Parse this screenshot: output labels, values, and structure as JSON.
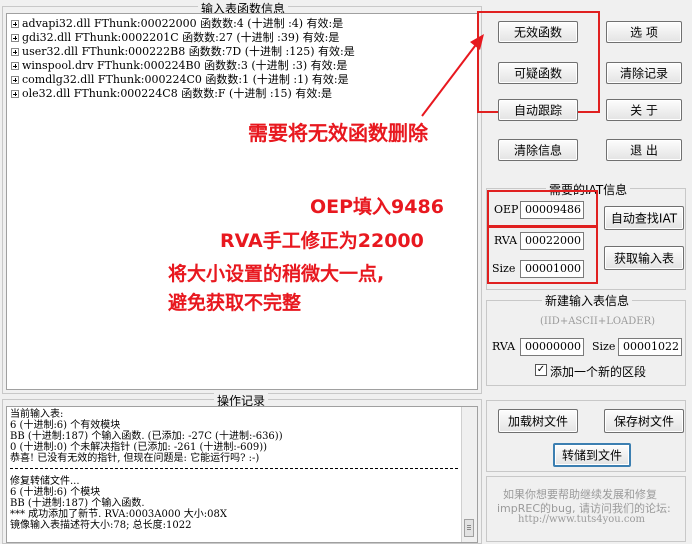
{
  "import_group": {
    "title": "输入表函数信息",
    "items": [
      "advapi32.dll FThunk:00022000 函数数:4 (十进制 :4) 有效:是",
      "gdi32.dll FThunk:0002201C 函数数:27 (十进制 :39) 有效:是",
      "user32.dll FThunk:000222B8 函数数:7D (十进制 :125) 有效:是",
      "winspool.drv FThunk:000224B0 函数数:3 (十进制 :3) 有效:是",
      "comdlg32.dll FThunk:000224C0 函数数:1 (十进制 :1) 有效:是",
      "ole32.dll FThunk:000224C8 函数数:F (十进制 :15) 有效:是"
    ]
  },
  "buttons": {
    "invalid_funcs": "无效函数",
    "options": "选  项",
    "suspicious_funcs": "可疑函数",
    "clear_log": "清除记录",
    "auto_trace": "自动跟踪",
    "about": "关  于",
    "clear_info": "清除信息",
    "exit": "退  出",
    "auto_find_iat": "自动查找IAT",
    "get_imports": "获取输入表",
    "load_tree": "加载树文件",
    "save_tree": "保存树文件",
    "dump_to_file": "转储到文件"
  },
  "annotations": {
    "delete_invalid": "需要将无效函数删除",
    "oep_fill": "OEP填入9486",
    "rva_fix": "RVA手工修正为22000",
    "size_line1": "将大小设置的稍微大一点,",
    "size_line2": "避免获取不完整"
  },
  "iat_group": {
    "title": "需要的IAT信息",
    "oep_label": "OEP",
    "oep_value": "00009486",
    "rva_label": "RVA",
    "rva_value": "00022000",
    "size_label": "Size",
    "size_value": "00001000"
  },
  "new_import_group": {
    "title": "新建输入表信息",
    "subtitle": "(IID+ASCII+LOADER)",
    "rva_label": "RVA",
    "rva_value": "00000000",
    "size_label": "Size",
    "size_value": "00001022",
    "add_section_label": "添加一个新的区段",
    "add_section_checked": true
  },
  "log_group": {
    "title": "操作记录",
    "lines": [
      "当前输入表:",
      "6 (十进制:6) 个有效模块",
      "BB (十进制:187) 个输入函数. (已添加: -27C (十进制:-636))",
      "0 (十进制:0) 个未解决指针 (已添加: -261 (十进制:-609))",
      "恭喜! 已没有无效的指针, 但现在问题是: 它能运行吗? :-)",
      "修复转储文件...",
      "6 (十进制:6) 个模块",
      "BB (十进制:187) 个输入函数.",
      "*** 成功添加了新节. RVA:0003A000 大小:08X",
      "镜像输入表描述符大小:78; 总长度:1022"
    ]
  },
  "footer": {
    "line1": "如果你想要帮助继续发展和修复",
    "line2": "impREC的bug, 请访问我们的论坛:",
    "url": "http://www.tuts4you.com"
  },
  "colors": {
    "annotation": "#e8181f"
  }
}
